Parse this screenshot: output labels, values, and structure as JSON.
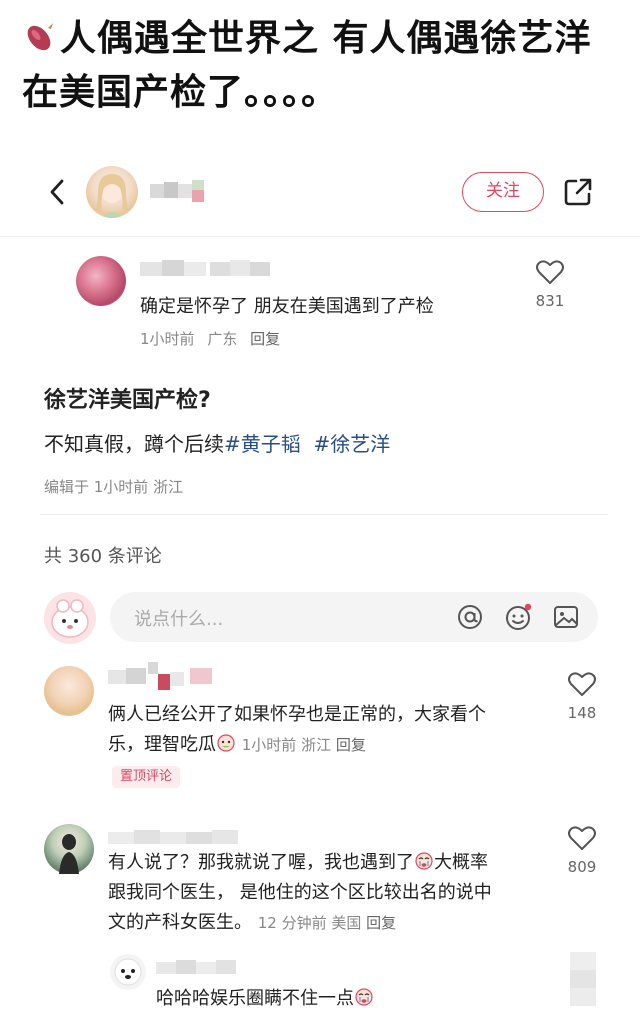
{
  "headline": {
    "text": "人偶遇全世界之 有人偶遇徐艺洋在美国产检了。。。。"
  },
  "topbar": {
    "follow_label": "关注"
  },
  "quoted_comment": {
    "text": "确定是怀孕了 朋友在美国遇到了产检",
    "time": "1小时前",
    "location": "广东",
    "reply_label": "回复",
    "likes": "831"
  },
  "post": {
    "title": "徐艺洋美国产检?",
    "body_prefix": "不知真假，蹲个后续",
    "tag1": "#黄子韬",
    "tag2": "#徐艺洋",
    "meta": "编辑于 1小时前 浙江"
  },
  "comments_header": {
    "count_text": "共 360 条评论"
  },
  "comment_input": {
    "placeholder": "说点什么..."
  },
  "comments": [
    {
      "text_line1": "俩人已经公开了如果怀孕也是正常的，大家看个",
      "text_line2_prefix": "乐，理智吃瓜",
      "time": "1小时前",
      "location": "浙江",
      "reply_label": "回复",
      "badge": "置顶评论",
      "likes": "148"
    },
    {
      "text_line1_prefix": "有人说了？那我就说了喔，我也遇到了",
      "text_line1_suffix": "大概率",
      "text_line2": "跟我同个医生， 是他住的这个区比较出名的说中",
      "text_line3": "文的产科女医生。",
      "time": "12 分钟前",
      "location": "美国",
      "reply_label": "回复",
      "likes": "809"
    }
  ],
  "sub_reply": {
    "text": "哈哈哈娱乐圈瞒不住一点"
  },
  "colors": {
    "accent": "#e3455e",
    "tag": "#264e8a"
  }
}
